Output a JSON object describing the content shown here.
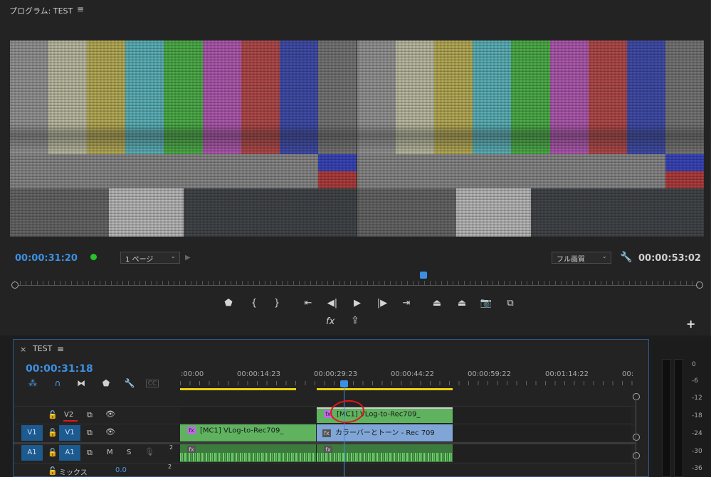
{
  "program": {
    "title": "プログラム: TEST",
    "menu_icon": "≡",
    "timecode_current": "00:00:31:20",
    "page_select": "1 ページ",
    "quality_select": "フル画質",
    "timecode_duration": "00:00:53:02",
    "controls": [
      {
        "name": "add-marker-button",
        "glyph": "⬟"
      },
      {
        "name": "mark-in-button",
        "glyph": "{"
      },
      {
        "name": "mark-out-button",
        "glyph": "}"
      },
      {
        "name": "go-to-in-button",
        "glyph": "⇤"
      },
      {
        "name": "step-back-button",
        "glyph": "◀|"
      },
      {
        "name": "play-button",
        "glyph": "▶"
      },
      {
        "name": "step-forward-button",
        "glyph": "|▶"
      },
      {
        "name": "go-to-out-button",
        "glyph": "⇥"
      },
      {
        "name": "lift-button",
        "glyph": "⏏"
      },
      {
        "name": "extract-button",
        "glyph": "⏏"
      },
      {
        "name": "export-frame-button",
        "glyph": "📷"
      },
      {
        "name": "comparison-view-button",
        "glyph": "⧉"
      }
    ],
    "fx_label": "fx",
    "plus": "+"
  },
  "timeline": {
    "close": "×",
    "title": "TEST",
    "menu_icon": "≡",
    "timecode": "00:00:31:18",
    "ruler": [
      ":00:00",
      "00:00:14:23",
      "00:00:29:23",
      "00:00:44:22",
      "00:00:59:22",
      "00:01:14:22",
      "00:"
    ],
    "tracks": {
      "v2": {
        "label": "V2"
      },
      "v1": {
        "source": "V1",
        "label": "V1"
      },
      "a1": {
        "source": "A1",
        "label": "A1",
        "m": "M",
        "s": "S",
        "num": "2"
      },
      "mix": {
        "label": "ミックス",
        "value": "0.0"
      }
    },
    "clips": {
      "v2_clip": "[MC1] VLog-to-Rec709_",
      "v1_clip": "[MC1] VLog-to-Rec709_",
      "v1_bars": "カラーバーとトーン - Rec 709"
    }
  },
  "vu_meter": {
    "labels": [
      "0",
      "-6",
      "-12",
      "-18",
      "-24",
      "-30",
      "-36"
    ]
  },
  "colors": {
    "accent_blue": "#3d8fe0",
    "clip_green": "#5fb35f",
    "clip_blue": "#7fa6d6",
    "marker_red": "#e01818"
  }
}
